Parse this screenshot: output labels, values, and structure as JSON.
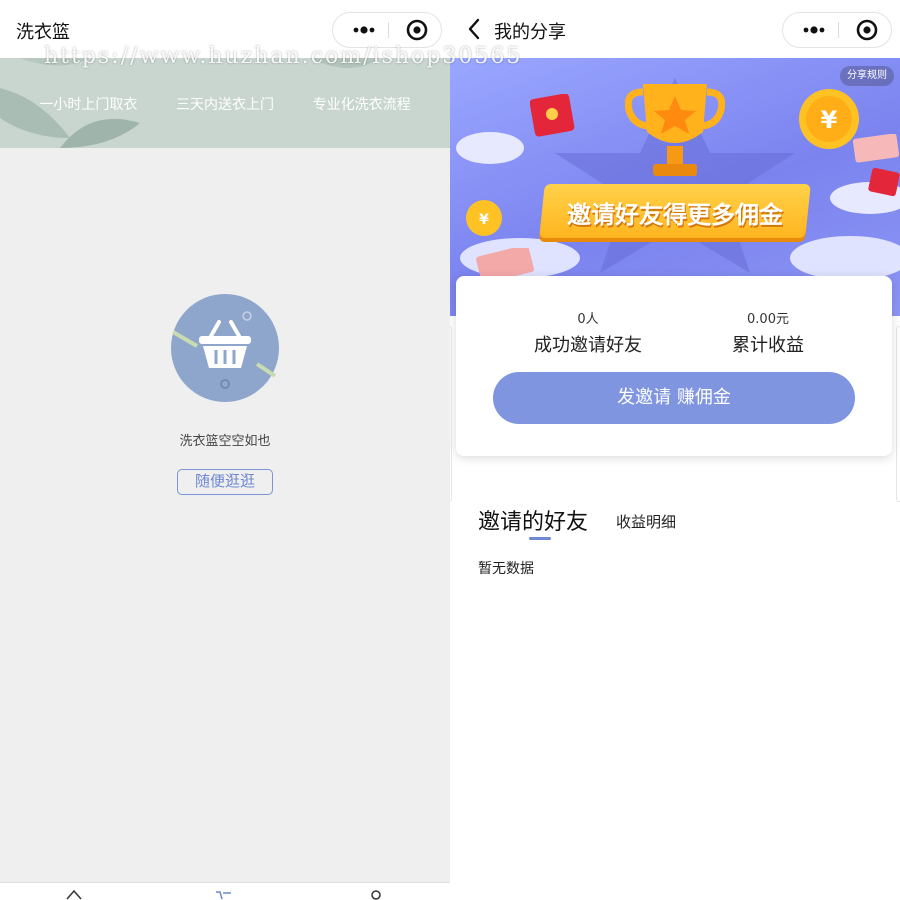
{
  "watermark": "https://www.huzhan.com/ishop30565",
  "left": {
    "title": "洗衣篮",
    "banner_tags": [
      "一小时上门取衣",
      "三天内送衣上门",
      "专业化洗衣流程"
    ],
    "empty_text": "洗衣篮空空如也",
    "browse_button": "随便逛逛",
    "icons": [
      "more-icon",
      "close-circle-icon",
      "basket-icon",
      "home-icon",
      "cart-icon",
      "user-icon"
    ]
  },
  "right": {
    "title": "我的分享",
    "share_rules": "分享规则",
    "banner_slogan": "邀请好友得更多佣金",
    "stats": [
      {
        "value": "0人",
        "label": "成功邀请好友"
      },
      {
        "value": "0.00元",
        "label": "累计收益"
      }
    ],
    "invite_button": "发邀请 赚佣金",
    "tabs": {
      "invited": "邀请的好友",
      "income": "收益明细"
    },
    "no_data": "暂无数据",
    "icons": [
      "back-arrow-icon",
      "trophy-icon",
      "coin-icon",
      "red-envelope-icon"
    ]
  },
  "colors": {
    "accent": "#7f95df",
    "left_background": "#efefef",
    "banner_purple": "#7b83ef",
    "ribbon": "#ffc02e"
  }
}
